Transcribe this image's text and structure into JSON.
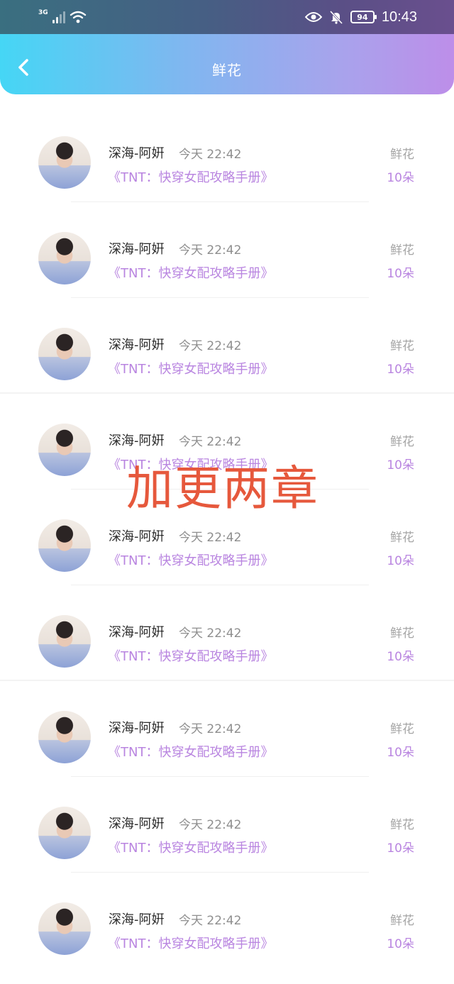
{
  "status_bar": {
    "network": "3G",
    "battery": "94",
    "time": "10:43"
  },
  "header": {
    "title": "鲜花"
  },
  "overlay_text": "加更两章",
  "items": [
    {
      "name": "深海-阿姸",
      "time": "今天 22:42",
      "book": "《TNT：快穿女配攻略手册》",
      "gift": "鲜花",
      "count": "10朵"
    },
    {
      "name": "深海-阿姸",
      "time": "今天 22:42",
      "book": "《TNT：快穿女配攻略手册》",
      "gift": "鲜花",
      "count": "10朵"
    },
    {
      "name": "深海-阿姸",
      "time": "今天 22:42",
      "book": "《TNT：快穿女配攻略手册》",
      "gift": "鲜花",
      "count": "10朵"
    },
    {
      "name": "深海-阿姸",
      "time": "今天 22:42",
      "book": "《TNT：快穿女配攻略手册》",
      "gift": "鲜花",
      "count": "10朵"
    },
    {
      "name": "深海-阿姸",
      "time": "今天 22:42",
      "book": "《TNT：快穿女配攻略手册》",
      "gift": "鲜花",
      "count": "10朵"
    },
    {
      "name": "深海-阿姸",
      "time": "今天 22:42",
      "book": "《TNT：快穿女配攻略手册》",
      "gift": "鲜花",
      "count": "10朵"
    },
    {
      "name": "深海-阿姸",
      "time": "今天 22:42",
      "book": "《TNT：快穿女配攻略手册》",
      "gift": "鲜花",
      "count": "10朵"
    },
    {
      "name": "深海-阿姸",
      "time": "今天 22:42",
      "book": "《TNT：快穿女配攻略手册》",
      "gift": "鲜花",
      "count": "10朵"
    },
    {
      "name": "深海-阿姸",
      "time": "今天 22:42",
      "book": "《TNT：快穿女配攻略手册》",
      "gift": "鲜花",
      "count": "10朵"
    }
  ]
}
